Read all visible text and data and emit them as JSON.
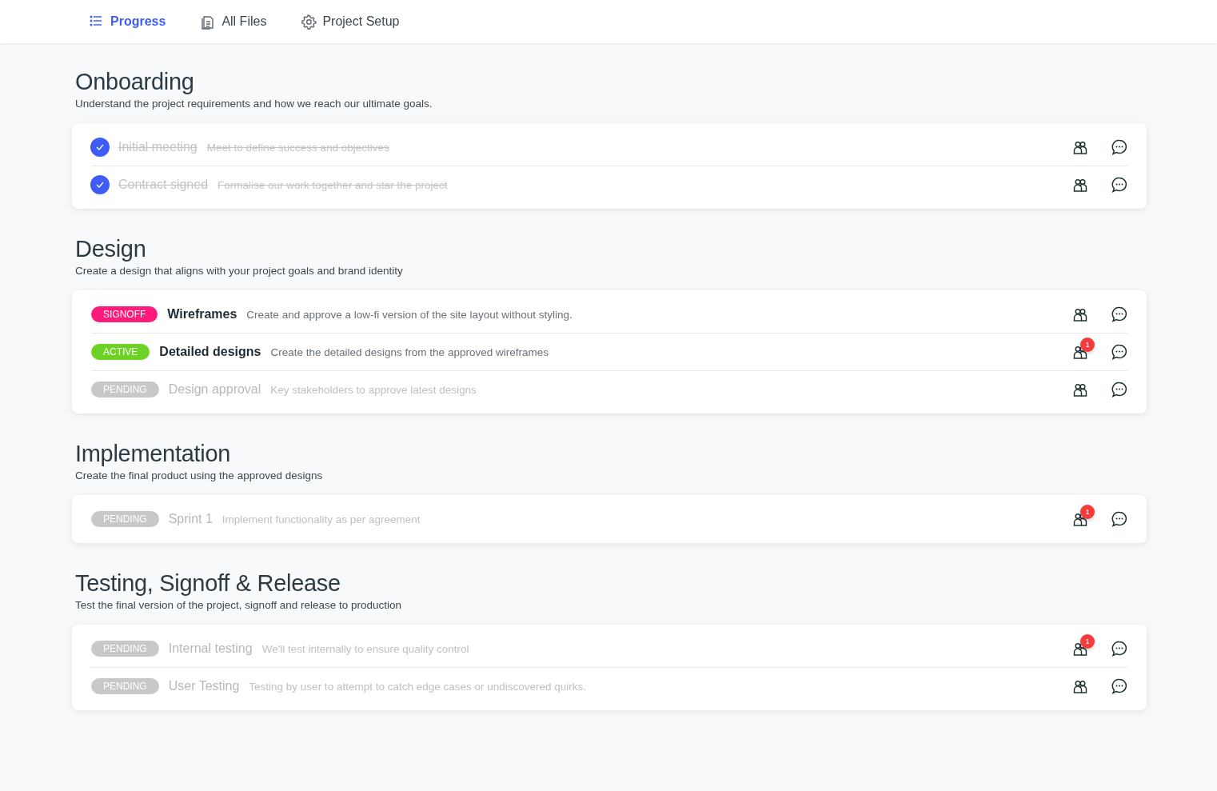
{
  "tabs": [
    {
      "label": "Progress",
      "selected": true
    },
    {
      "label": "All Files",
      "selected": false
    },
    {
      "label": "Project Setup",
      "selected": false
    }
  ],
  "sections": [
    {
      "title": "Onboarding",
      "description": "Understand the project requirements and how we reach our ultimate goals.",
      "tasks": [
        {
          "kind": "check",
          "checked": true,
          "title": "Initial meeting",
          "description": "Meet to define success and objectives"
        },
        {
          "kind": "check",
          "checked": true,
          "title": "Contract signed",
          "description": "Formalise our work together and star the project"
        }
      ]
    },
    {
      "title": "Design",
      "description": "Create a design that aligns with your project goals and brand identity",
      "tasks": [
        {
          "kind": "signoff",
          "status": "SIGNOFF",
          "title": "Wireframes",
          "description": "Create and approve a low-fi version of the site layout without styling."
        },
        {
          "kind": "active",
          "status": "ACTIVE",
          "title": "Detailed designs",
          "description": "Create the detailed designs from the approved wireframes",
          "badge": "1"
        },
        {
          "kind": "pending",
          "status": "PENDING",
          "title": "Design approval",
          "description": "Key stakeholders to approve latest designs"
        }
      ]
    },
    {
      "title": "Implementation",
      "description": "Create the final product using the approved designs",
      "tasks": [
        {
          "kind": "pending",
          "status": "PENDING",
          "title": "Sprint 1",
          "description": "Implement functionality as per agreement",
          "badge": "1"
        }
      ]
    },
    {
      "title": "Testing, Signoff & Release",
      "description": "Test the final version of the project, signoff and release to production",
      "tasks": [
        {
          "kind": "pending",
          "status": "PENDING",
          "title": "Internal testing",
          "description": "We'll test internally to ensure quality control",
          "badge": "1"
        },
        {
          "kind": "pending",
          "status": "PENDING",
          "title": "User Testing",
          "description": "Testing by user to attempt to catch edge cases or undiscovered quirks."
        }
      ]
    }
  ]
}
